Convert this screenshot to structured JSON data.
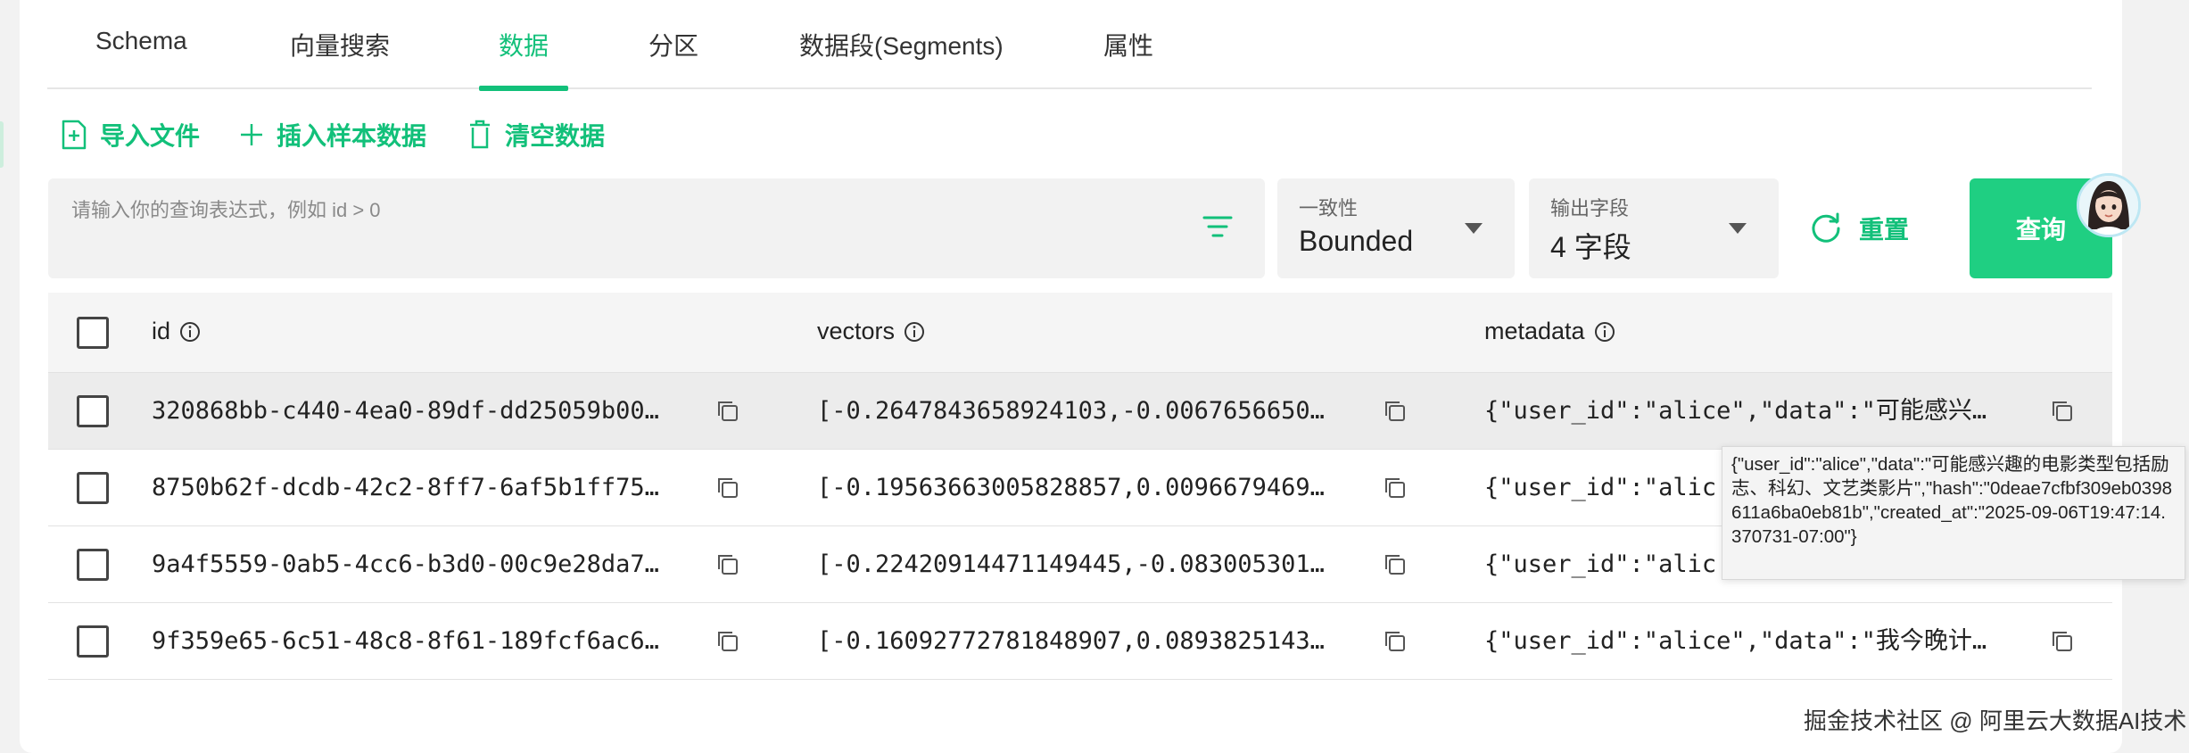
{
  "tabs": [
    {
      "label": "Schema"
    },
    {
      "label": "向量搜索"
    },
    {
      "label": "数据"
    },
    {
      "label": "分区"
    },
    {
      "label": "数据段(Segments)"
    },
    {
      "label": "属性"
    }
  ],
  "active_tab": "数据",
  "toolbar": {
    "import_label": "导入文件",
    "insert_sample_label": "插入样本数据",
    "clear_label": "清空数据"
  },
  "query": {
    "placeholder": "请输入你的查询表达式，例如 id > 0",
    "value": ""
  },
  "consistency": {
    "label": "一致性",
    "value": "Bounded"
  },
  "output_fields": {
    "label": "输出字段",
    "value": "4 字段"
  },
  "reset_label": "重置",
  "query_label": "查询",
  "table": {
    "columns": [
      {
        "label": "id"
      },
      {
        "label": "vectors"
      },
      {
        "label": "metadata"
      }
    ],
    "rows": [
      {
        "id": "320868bb-c440-4ea0-89df-dd25059b00…",
        "vectors": "[-0.2647843658924103,-0.0067656650…",
        "metadata": "{\"user_id\":\"alice\",\"data\":\"可能感兴…"
      },
      {
        "id": "8750b62f-dcdb-42c2-8ff7-6af5b1ff75…",
        "vectors": "[-0.19563663005828857,0.0096679469…",
        "metadata": "{\"user_id\":\"alic"
      },
      {
        "id": "9a4f5559-0ab5-4cc6-b3d0-00c9e28da7…",
        "vectors": "[-0.22420914471149445,-0.083005301…",
        "metadata": "{\"user_id\":\"alic"
      },
      {
        "id": "9f359e65-6c51-48c8-8f61-189fcf6ac6…",
        "vectors": "[-0.16092772781848907,0.0893825143…",
        "metadata": "{\"user_id\":\"alice\",\"data\":\"我今晚计…"
      }
    ]
  },
  "tooltip": {
    "text": "{\"user_id\":\"alice\",\"data\":\"可能感兴趣的电影类型包括励志、科幻、文艺类影片\",\"hash\":\"0deae7cfbf309eb0398611a6ba0eb81b\",\"created_at\":\"2025-09-06T19:47:14.370731-07:00\"}"
  },
  "watermark": "掘金技术社区 @ 阿里云大数据AI技术",
  "colors": {
    "accent": "#12c07a",
    "query_button": "#1fcf82"
  }
}
